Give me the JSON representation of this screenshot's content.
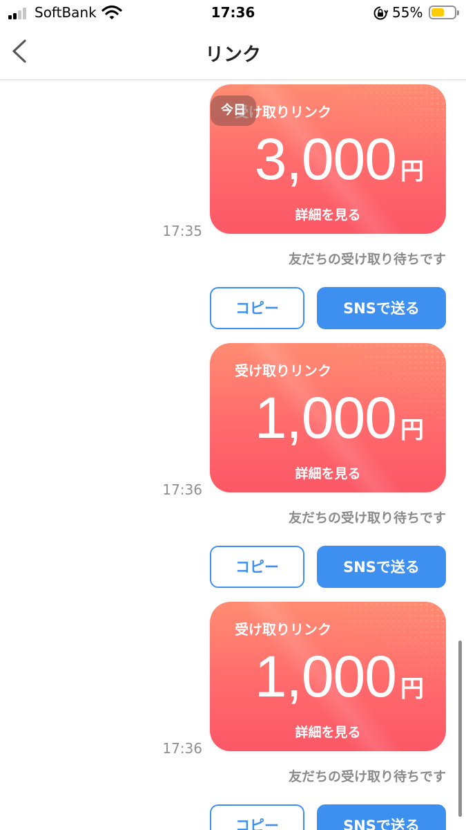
{
  "status_bar": {
    "carrier": "SoftBank",
    "time": "17:36",
    "battery_percent": "55%",
    "battery_level": 0.55,
    "signal_bars": 2,
    "icons": [
      "signal-icon",
      "wifi-icon",
      "orientation-lock-icon",
      "battery-icon"
    ]
  },
  "nav": {
    "title": "リンク",
    "back_icon": "chevron-left-icon"
  },
  "date_badge": "今日",
  "messages": [
    {
      "label": "受け取りリンク",
      "amount": "3,000",
      "currency": "円",
      "details_label": "詳細を見る",
      "time": "17:35",
      "status": "友だちの受け取り待ちです",
      "copy_label": "コピー",
      "sns_label": "SNSで送る"
    },
    {
      "label": "受け取りリンク",
      "amount": "1,000",
      "currency": "円",
      "details_label": "詳細を見る",
      "time": "17:36",
      "status": "友だちの受け取り待ちです",
      "copy_label": "コピー",
      "sns_label": "SNSで送る"
    },
    {
      "label": "受け取りリンク",
      "amount": "1,000",
      "currency": "円",
      "details_label": "詳細を見る",
      "time": "17:36",
      "status": "友だちの受け取り待ちです",
      "copy_label": "コピー",
      "sns_label": "SNSで送る"
    }
  ],
  "colors": {
    "accent": "#3d8ff0",
    "card_top": "#ff8c72",
    "card_bottom": "#fc5766",
    "battery": "#ffcc00",
    "muted_text": "#8a8a8a"
  }
}
